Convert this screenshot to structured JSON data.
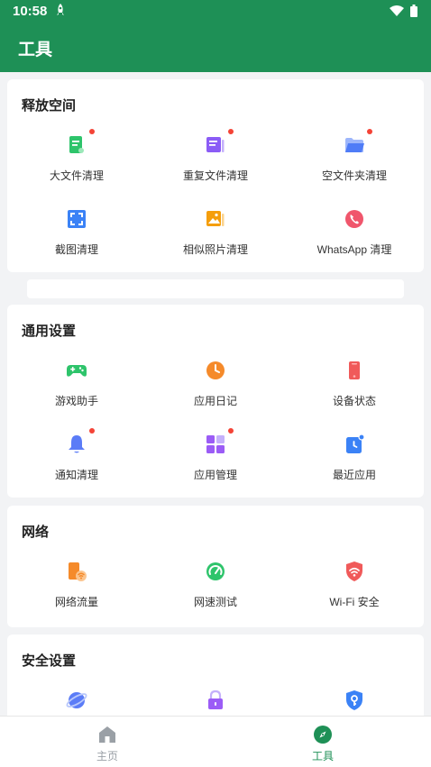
{
  "status_bar": {
    "time": "10:58",
    "icons": [
      "rocket-icon",
      "wifi-icon",
      "battery-icon"
    ]
  },
  "app_bar": {
    "title": "工具"
  },
  "sections": [
    {
      "title": "释放空间",
      "items": [
        {
          "label": "大文件清理",
          "icon": "large-file-icon",
          "color": "#2ec46b",
          "badge": true
        },
        {
          "label": "重复文件清理",
          "icon": "duplicate-file-icon",
          "color": "#8b5cf6",
          "badge": true
        },
        {
          "label": "空文件夹清理",
          "icon": "empty-folder-icon",
          "color": "#4f7cf7",
          "badge": true
        },
        {
          "label": "截图清理",
          "icon": "screenshot-icon",
          "color": "#3b82f6",
          "badge": false
        },
        {
          "label": "相似照片清理",
          "icon": "similar-photo-icon",
          "color": "#f59e0b",
          "badge": false
        },
        {
          "label": "WhatsApp 清理",
          "icon": "whatsapp-icon",
          "color": "#f0566c",
          "badge": false
        }
      ]
    },
    {
      "title": "通用设置",
      "items": [
        {
          "label": "游戏助手",
          "icon": "gamepad-icon",
          "color": "#2ec46b",
          "badge": false
        },
        {
          "label": "应用日记",
          "icon": "clock-icon",
          "color": "#f58a2a",
          "badge": false
        },
        {
          "label": "设备状态",
          "icon": "phone-icon",
          "color": "#f05a5a",
          "badge": false
        },
        {
          "label": "通知清理",
          "icon": "bell-icon",
          "color": "#5b7cf7",
          "badge": true
        },
        {
          "label": "应用管理",
          "icon": "app-grid-icon",
          "color": "#9b5cf6",
          "badge": true
        },
        {
          "label": "最近应用",
          "icon": "recent-app-icon",
          "color": "#3b82f6",
          "badge": false
        }
      ]
    },
    {
      "title": "网络",
      "items": [
        {
          "label": "网络流量",
          "icon": "data-usage-icon",
          "color": "#f58a2a",
          "badge": false
        },
        {
          "label": "网速测试",
          "icon": "speedometer-icon",
          "color": "#2ec46b",
          "badge": false
        },
        {
          "label": "Wi-Fi 安全",
          "icon": "wifi-shield-icon",
          "color": "#f05a5a",
          "badge": false
        }
      ]
    },
    {
      "title": "安全设置",
      "items": [
        {
          "label": "",
          "icon": "planet-icon",
          "color": "#5b7cf7",
          "badge": false
        },
        {
          "label": "",
          "icon": "lock-icon",
          "color": "#9b5cf6",
          "badge": false
        },
        {
          "label": "",
          "icon": "shield-key-icon",
          "color": "#3b82f6",
          "badge": false
        }
      ]
    }
  ],
  "bottom_nav": {
    "items": [
      {
        "label": "主页",
        "icon": "home-icon",
        "active": false
      },
      {
        "label": "工具",
        "icon": "compass-icon",
        "active": true
      }
    ],
    "active_color": "#1e9056",
    "inactive_color": "#9aa0a6"
  }
}
